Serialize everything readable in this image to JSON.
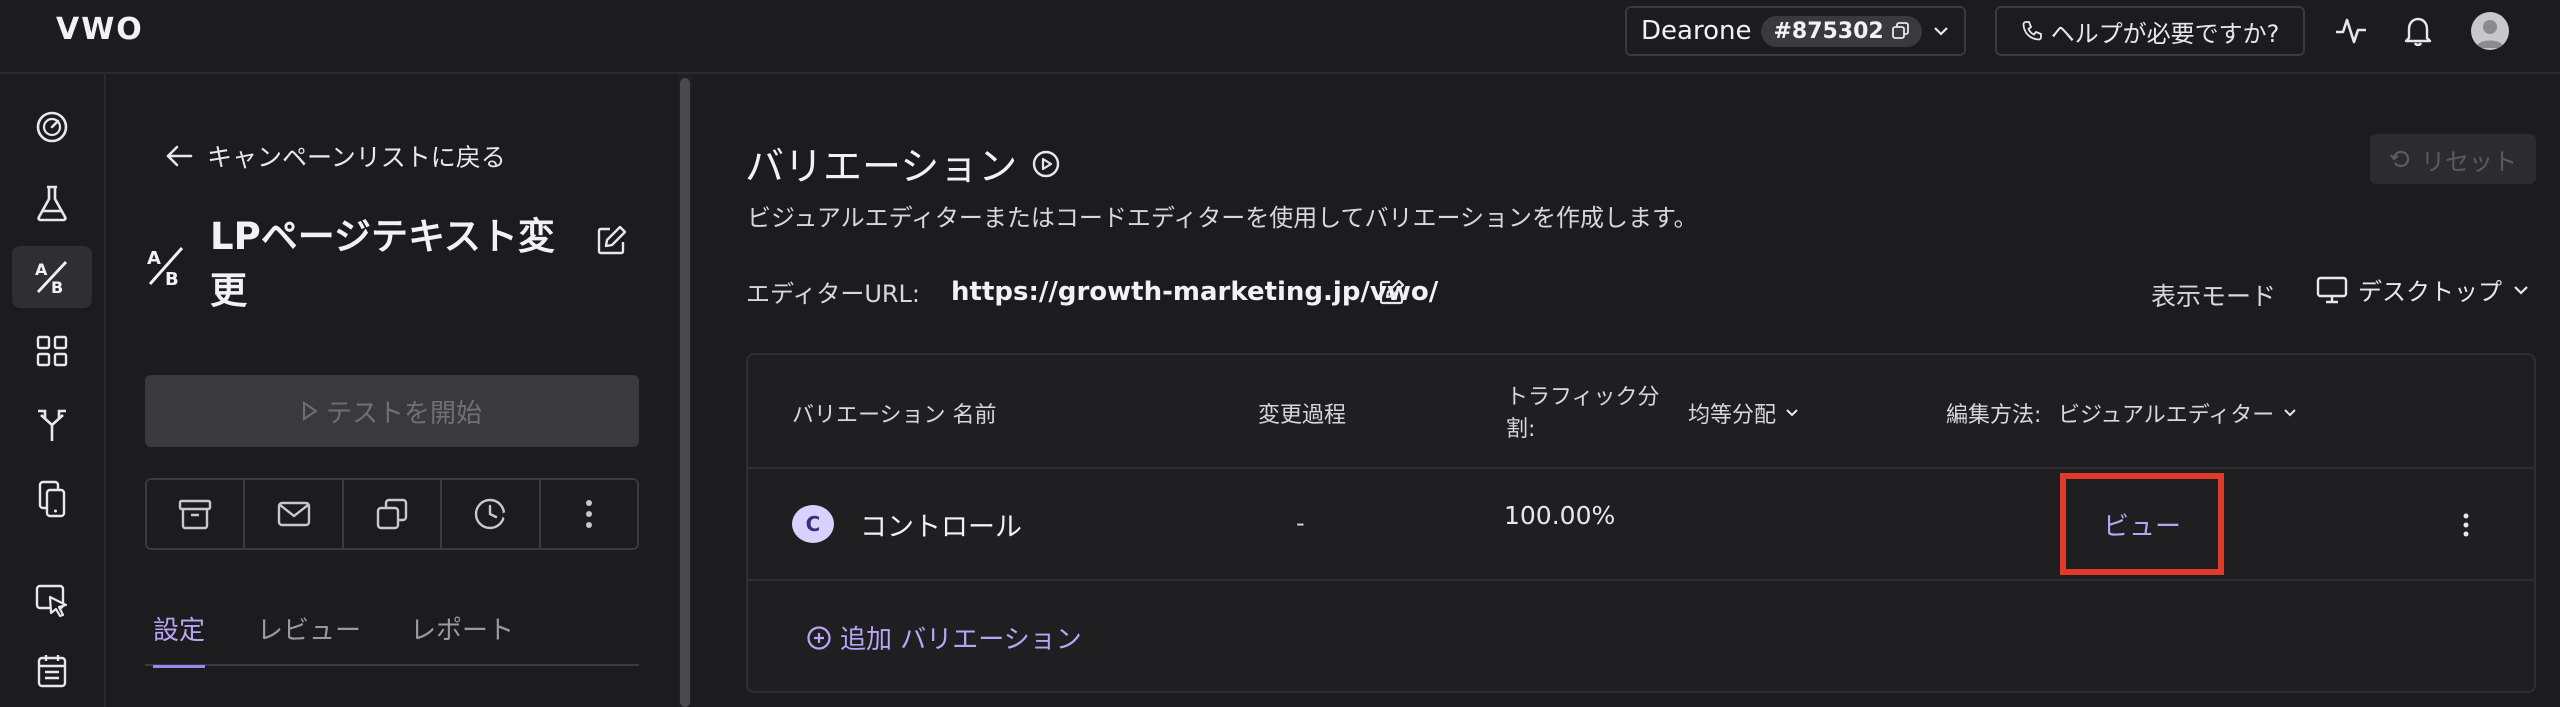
{
  "topbar": {
    "logo": "VWO",
    "account_name": "Dearone",
    "account_id": "#875302",
    "help_label": "ヘルプが必要ですか?"
  },
  "rail": {
    "items": [
      {
        "icon": "dashboard-gauge-icon"
      },
      {
        "icon": "flask-icon"
      },
      {
        "icon": "ab-test-icon",
        "active": true
      },
      {
        "icon": "apps-grid-icon"
      },
      {
        "icon": "split-arrow-icon"
      },
      {
        "icon": "mobile-copy-icon"
      },
      {
        "icon": "cursor-click-icon"
      },
      {
        "icon": "calendar-list-icon"
      }
    ]
  },
  "sidepanel": {
    "back_label": "キャンペーンリストに戻る",
    "campaign_title": "LPページテキスト変更",
    "start_label": "テストを開始",
    "tabs": [
      "設定",
      "レビュー",
      "レポート"
    ]
  },
  "main": {
    "title": "バリエーション",
    "subtitle": "ビジュアルエディターまたはコードエディターを使用してバリエーションを作成します。",
    "reset_label": "リセット",
    "editor_url_label": "エディターURL:",
    "editor_url": "https://growth-marketing.jp/vwo/",
    "view_mode_label": "表示モード",
    "device_label": "デスクトップ"
  },
  "table": {
    "headers": {
      "name": "バリエーション 名前",
      "changes": "変更過程",
      "traffic_line1": "トラフィック分",
      "traffic_line2": "割:",
      "distribution": "均等分配",
      "edit_method_label": "編集方法:",
      "edit_method_value": "ビジュアルエディター"
    },
    "rows": [
      {
        "badge": "C",
        "name": "コントロール",
        "changes": "-",
        "traffic": "100.00%",
        "action": "ビュー"
      }
    ],
    "add_label": "追加 バリエーション"
  },
  "colors": {
    "accent": "#9d85f0",
    "highlight_box": "#e03a2b",
    "background": "#1c1c1e"
  }
}
